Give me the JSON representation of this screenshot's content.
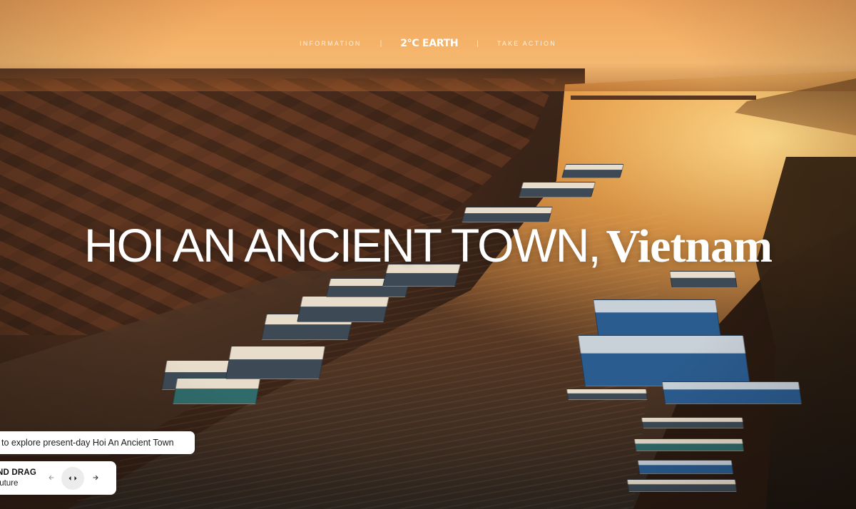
{
  "nav": {
    "left_label": "INFORMATION",
    "separator": "|",
    "brand": "2°C EARTH",
    "right_label": "TAKE ACTION"
  },
  "headline": {
    "main": "HOI AN ANCIENT TOWN,",
    "accent": "Vietnam"
  },
  "hint": {
    "text": "to explore present-day Hoi An Ancient Town"
  },
  "drag_control": {
    "title": "ND DRAG",
    "subtitle": "future",
    "left_icon": "arrow-left-icon",
    "right_icon": "arrow-right-icon",
    "handle_icon": "drag-handle-icon"
  },
  "colors": {
    "sky": "#f0a45c",
    "card_bg": "#ffffff",
    "text_dark": "#1a1a1a",
    "headline": "#ffffff"
  }
}
